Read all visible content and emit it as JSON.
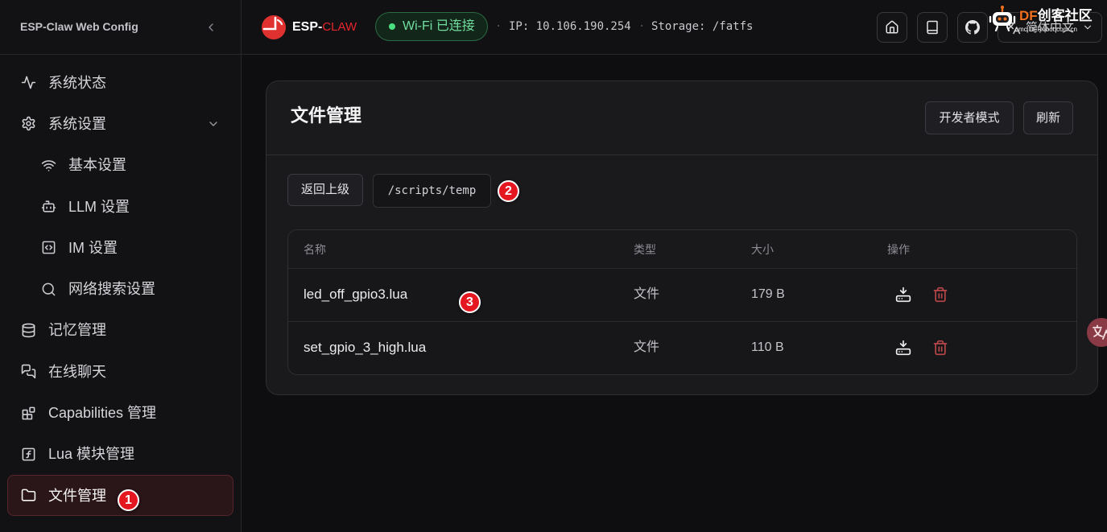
{
  "app": {
    "title": "ESP-Claw Web Config"
  },
  "sidebar": {
    "items": [
      {
        "label": "系统状态",
        "icon": "activity-icon"
      },
      {
        "label": "系统设置",
        "icon": "gear-icon",
        "expanded": true
      },
      {
        "label": "基本设置",
        "icon": "wifi-icon",
        "sub": true
      },
      {
        "label": "LLM 设置",
        "icon": "bot-icon",
        "sub": true
      },
      {
        "label": "IM 设置",
        "icon": "code-box-icon",
        "sub": true
      },
      {
        "label": "网络搜索设置",
        "icon": "search-icon",
        "sub": true
      },
      {
        "label": "记忆管理",
        "icon": "database-icon"
      },
      {
        "label": "在线聊天",
        "icon": "chat-icon"
      },
      {
        "label": "Capabilities 管理",
        "icon": "blocks-icon"
      },
      {
        "label": "Lua 模块管理",
        "icon": "function-square-icon"
      },
      {
        "label": "文件管理",
        "icon": "folder-icon",
        "active": true
      }
    ]
  },
  "topbar": {
    "brand": {
      "prefix": "ESP-",
      "suffix": "CLAW",
      "logo_icon": "esp-claw-logo-icon"
    },
    "wifi": {
      "label": "Wi-Fi 已连接",
      "connected": true
    },
    "separator": "·",
    "ip": "IP: 10.106.190.254",
    "storage": "Storage: /fatfs",
    "actions": [
      {
        "icon": "home-icon"
      },
      {
        "icon": "book-icon"
      },
      {
        "icon": "github-icon"
      }
    ],
    "language": {
      "selected": "简体中文",
      "icon": "languages-icon"
    }
  },
  "watermark": {
    "brand": "DF",
    "name": "创客社区",
    "domain": "mc.DFRobot.com.cn"
  },
  "file_manager": {
    "title": "文件管理",
    "developer_mode_label": "开发者模式",
    "refresh_label": "刷新",
    "back_label": "返回上级",
    "current_path": "/scripts/temp",
    "columns": [
      "名称",
      "类型",
      "大小",
      "操作"
    ],
    "rows": [
      {
        "name": "led_off_gpio3.lua",
        "type": "文件",
        "size": "179 B"
      },
      {
        "name": "set_gpio_3_high.lua",
        "type": "文件",
        "size": "110 B"
      }
    ]
  },
  "annotations": [
    "1",
    "2",
    "3"
  ],
  "floating": {
    "icon": "translate-icon"
  },
  "colors": {
    "accent": "#e5262c",
    "success": "#4ade80",
    "danger": "#b9474a",
    "annotation": "#e4161f",
    "background": "#0e0e10",
    "card": "#1a1a1d",
    "active_item": "#2a1518"
  }
}
